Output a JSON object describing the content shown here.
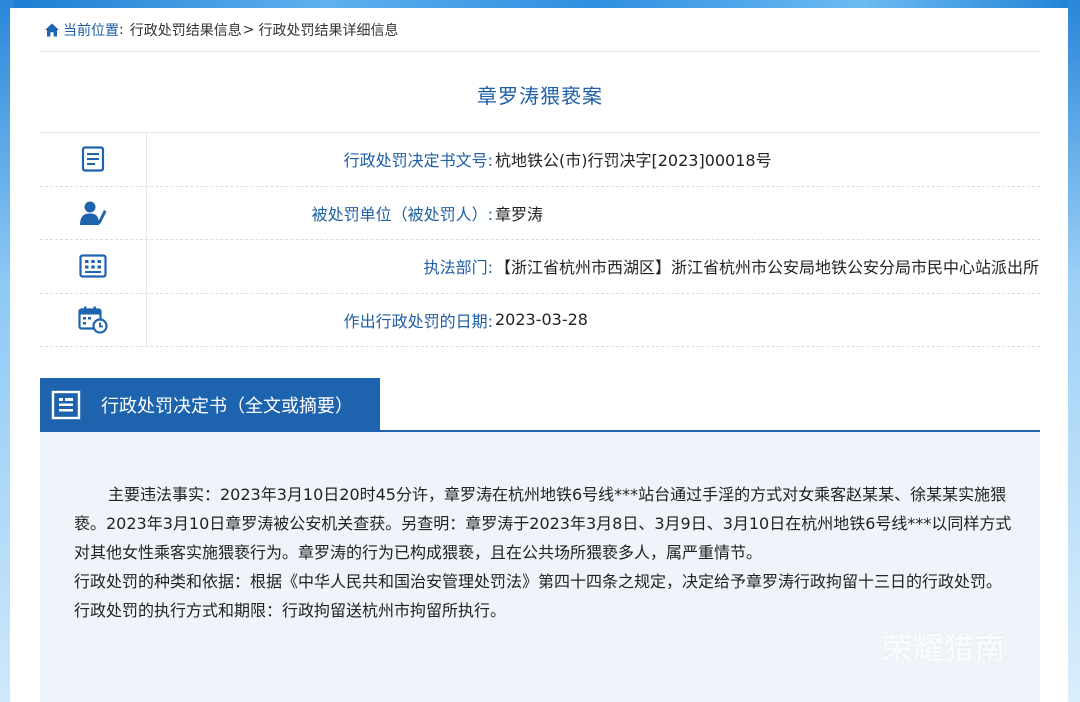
{
  "breadcrumb": {
    "current_label": "当前位置",
    "sep": ":",
    "path1": "行政处罚结果信息",
    "gt": ">",
    "path2": "行政处罚结果详细信息"
  },
  "case_title": "章罗涛猥亵案",
  "info_rows": [
    {
      "icon": "document-icon",
      "label": "行政处罚决定书文号:",
      "value": "杭地铁公(市)行罚决字[2023]00018号"
    },
    {
      "icon": "person-icon",
      "label": "被处罚单位（被处罚人）:",
      "value": "章罗涛"
    },
    {
      "icon": "building-icon",
      "label": "执法部门:",
      "value": "【浙江省杭州市西湖区】浙江省杭州市公安局地铁公安分局市民中心站派出所"
    },
    {
      "icon": "calendar-clock-icon",
      "label": "作出行政处罚的日期:",
      "value": "2023-03-28"
    }
  ],
  "section": {
    "icon": "document-list-icon",
    "title": "行政处罚决定书（全文或摘要）"
  },
  "content": {
    "para1": "主要违法事实：2023年3月10日20时45分许，章罗涛在杭州地铁6号线***站台通过手淫的方式对女乘客赵某某、徐某某实施猥亵。2023年3月10日章罗涛被公安机关查获。另查明：章罗涛于2023年3月8日、3月9日、3月10日在杭州地铁6号线***以同样方式对其他女性乘客实施猥亵行为。章罗涛的行为已构成猥亵，且在公共场所猥亵多人，属严重情节。",
    "para2": "行政处罚的种类和依据：根据《中华人民共和国治安管理处罚法》第四十四条之规定，决定给予章罗涛行政拘留十三日的行政处罚。",
    "para3": "行政处罚的执行方式和期限：行政拘留送杭州市拘留所执行。"
  },
  "watermark": "荣耀猎南",
  "colors": {
    "primary": "#1d63ad",
    "label_blue": "#1e5fa6",
    "content_bg": "#eef4fa"
  }
}
